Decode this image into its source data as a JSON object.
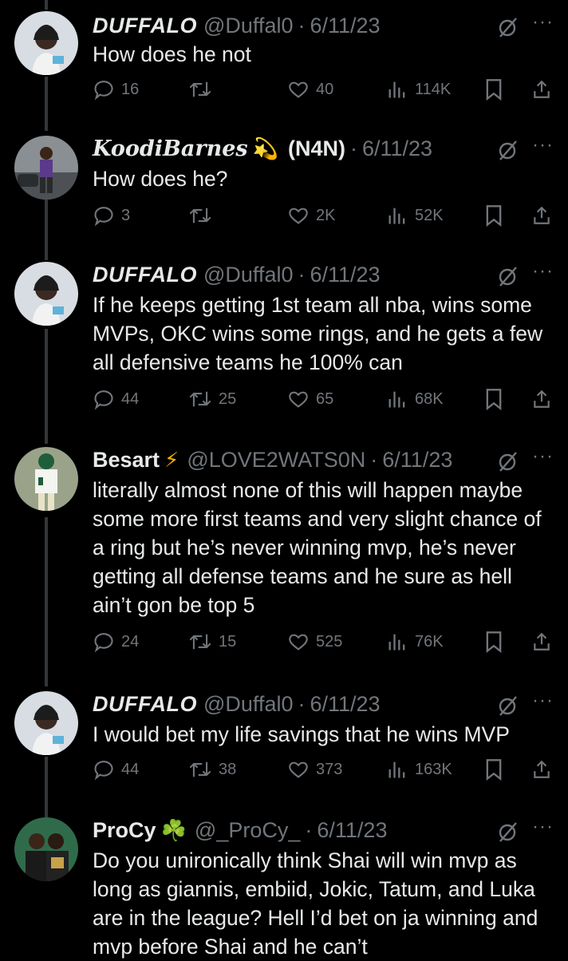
{
  "tweets": [
    {
      "name": "DUFFALO",
      "handle": "@Duffal0",
      "date": "6/11/23",
      "text": "How does he not",
      "replies": "16",
      "retweets": "",
      "likes": "40",
      "views": "114K"
    },
    {
      "name": "KoodiBarnes",
      "name_emoji": "💫",
      "handle": "(N4N)",
      "date": "6/11/23",
      "text": "How does he?",
      "replies": "3",
      "retweets": "",
      "likes": "2K",
      "views": "52K"
    },
    {
      "name": "DUFFALO",
      "handle": "@Duffal0",
      "date": "6/11/23",
      "text": "If he keeps getting 1st team all nba, wins some MVPs, OKC wins some rings, and he gets a few all defensive teams he 100% can",
      "replies": "44",
      "retweets": "25",
      "likes": "65",
      "views": "68K"
    },
    {
      "name": "Besart",
      "name_emoji": "⚡",
      "handle": "@LOVE2WATS0N",
      "date": "6/11/23",
      "text": "literally almost none of this will happen maybe some more first teams and very slight chance of a ring but he’s never winning mvp, he’s never getting all defense teams and he sure as hell ain’t gon be top 5",
      "replies": "24",
      "retweets": "15",
      "likes": "525",
      "views": "76K"
    },
    {
      "name": "DUFFALO",
      "handle": "@Duffal0",
      "date": "6/11/23",
      "text": "I would bet my life savings that he wins MVP",
      "replies": "44",
      "retweets": "38",
      "likes": "373",
      "views": "163K"
    },
    {
      "name": "ProCy",
      "name_emoji": "☘️",
      "handle": "@_ProCy_",
      "date": "6/11/23",
      "text": "Do you unironically think Shai will win mvp as long as giannis, embiid, Jokic, Tatum, and Luka are in the league? Hell I’d bet on ja winning and mvp before Shai and he can’t",
      "replies": "",
      "retweets": "",
      "likes": "",
      "views": ""
    }
  ],
  "colors": {
    "background": "#000000",
    "text": "#e7e9ea",
    "muted": "#71767b",
    "thread": "#333639"
  },
  "icons": [
    "reply-icon",
    "retweet-icon",
    "like-icon",
    "views-icon",
    "bookmark-icon",
    "share-icon",
    "grok-icon",
    "more-icon"
  ]
}
